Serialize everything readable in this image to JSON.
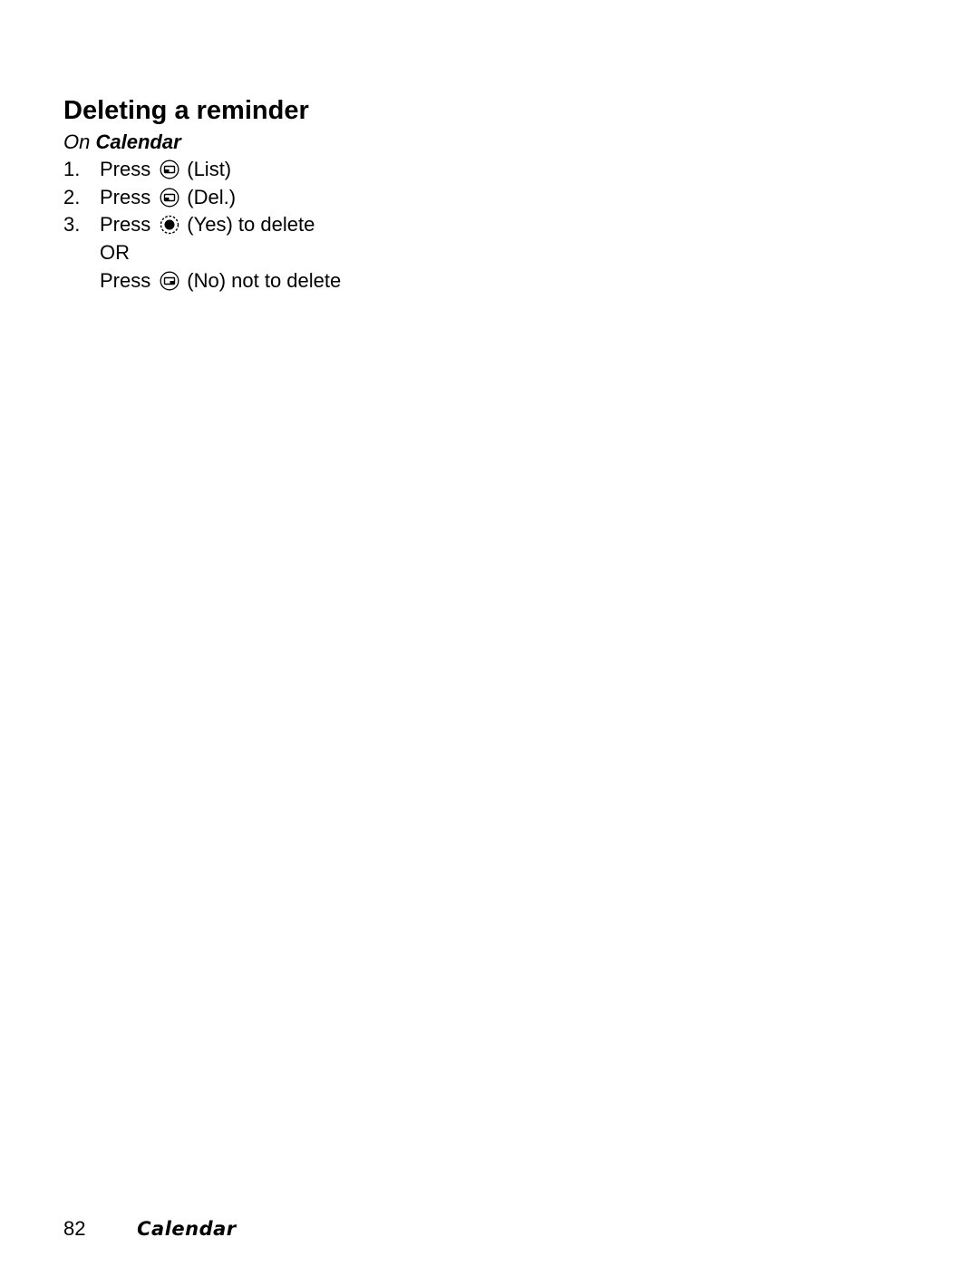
{
  "heading": "Deleting a reminder",
  "context": {
    "prefix": "On",
    "menu": "Calendar"
  },
  "steps": [
    {
      "number": "1.",
      "verb": "Press",
      "icon": "left-soft-key-icon",
      "text": "(List)"
    },
    {
      "number": "2.",
      "verb": "Press",
      "icon": "left-soft-key-icon",
      "text": "(Del.)"
    },
    {
      "number": "3.",
      "verb": "Press",
      "icon": "center-key-icon",
      "text": "(Yes) to delete"
    },
    {
      "number": "",
      "verb": "OR",
      "icon": "",
      "text": ""
    },
    {
      "number": "",
      "verb": "Press",
      "icon": "right-soft-key-icon",
      "text": "(No) not to delete"
    }
  ],
  "footer": {
    "page_number": "82",
    "section": "Calendar"
  }
}
